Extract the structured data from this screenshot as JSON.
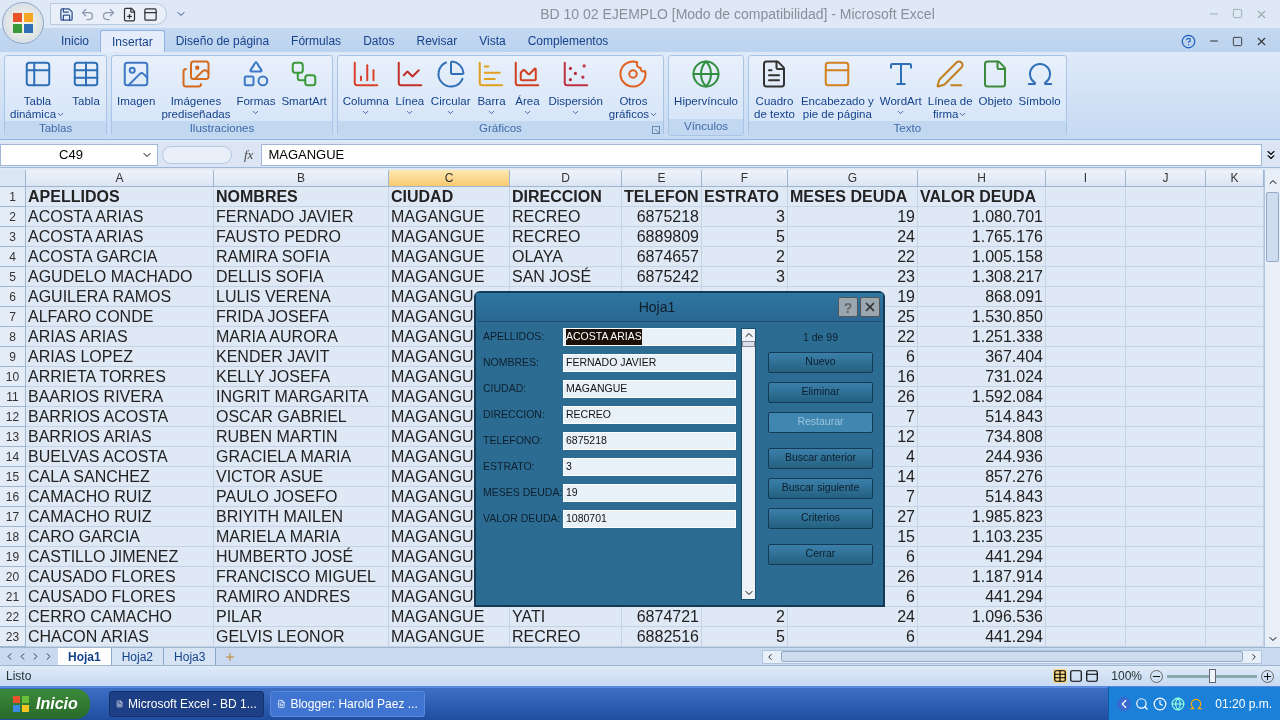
{
  "window": {
    "title": "BD 10 02 EJEMPLO  [Modo de compatibilidad] - Microsoft Excel"
  },
  "ribbon_tabs": [
    {
      "label": "Inicio",
      "selected": false
    },
    {
      "label": "Insertar",
      "selected": true
    },
    {
      "label": "Diseño de página",
      "selected": false
    },
    {
      "label": "Fórmulas",
      "selected": false
    },
    {
      "label": "Datos",
      "selected": false
    },
    {
      "label": "Revisar",
      "selected": false
    },
    {
      "label": "Vista",
      "selected": false
    },
    {
      "label": "Complementos",
      "selected": false
    }
  ],
  "ribbon_groups": [
    {
      "label": "Tablas",
      "launcher": false,
      "items": [
        {
          "lines": [
            "Tabla",
            "dinámica"
          ],
          "dropdown": true
        },
        {
          "lines": [
            "Tabla"
          ],
          "dropdown": false
        }
      ]
    },
    {
      "label": "Ilustraciones",
      "launcher": false,
      "items": [
        {
          "lines": [
            "Imagen"
          ],
          "dropdown": false
        },
        {
          "lines": [
            "Imágenes",
            "prediseñadas"
          ],
          "dropdown": false
        },
        {
          "lines": [
            "Formas"
          ],
          "dropdown": true
        },
        {
          "lines": [
            "SmartArt"
          ],
          "dropdown": false
        }
      ]
    },
    {
      "label": "Gráficos",
      "launcher": true,
      "items": [
        {
          "lines": [
            "Columna"
          ],
          "dropdown": true
        },
        {
          "lines": [
            "Línea"
          ],
          "dropdown": true
        },
        {
          "lines": [
            "Circular"
          ],
          "dropdown": true
        },
        {
          "lines": [
            "Barra"
          ],
          "dropdown": true
        },
        {
          "lines": [
            "Área"
          ],
          "dropdown": true
        },
        {
          "lines": [
            "Dispersión"
          ],
          "dropdown": true
        },
        {
          "lines": [
            "Otros",
            "gráficos"
          ],
          "dropdown": true
        }
      ]
    },
    {
      "label": "Vínculos",
      "launcher": false,
      "items": [
        {
          "lines": [
            "Hipervínculo"
          ],
          "dropdown": false
        }
      ]
    },
    {
      "label": "Texto",
      "launcher": false,
      "items": [
        {
          "lines": [
            "Cuadro",
            "de texto"
          ],
          "dropdown": false
        },
        {
          "lines": [
            "Encabezado y",
            "pie de página"
          ],
          "dropdown": false
        },
        {
          "lines": [
            "WordArt"
          ],
          "dropdown": true
        },
        {
          "lines": [
            "Línea de",
            "firma"
          ],
          "dropdown": true
        },
        {
          "lines": [
            "Objeto"
          ],
          "dropdown": false
        },
        {
          "lines": [
            "Símbolo"
          ],
          "dropdown": false
        }
      ]
    }
  ],
  "formula_bar": {
    "name_box": "C49",
    "fx": "fx",
    "formula": "MAGANGUE"
  },
  "columns": [
    {
      "label": "A",
      "selected": false
    },
    {
      "label": "B",
      "selected": false
    },
    {
      "label": "C",
      "selected": true
    },
    {
      "label": "D",
      "selected": false
    },
    {
      "label": "E",
      "selected": false
    },
    {
      "label": "F",
      "selected": false
    },
    {
      "label": "G",
      "selected": false
    },
    {
      "label": "H",
      "selected": false
    },
    {
      "label": "I",
      "selected": false
    },
    {
      "label": "J",
      "selected": false
    },
    {
      "label": "K",
      "selected": false
    }
  ],
  "header_row": {
    "n": "1",
    "A": "APELLIDOS",
    "B": "NOMBRES",
    "C": "CIUDAD",
    "D": "DIRECCION",
    "E": "TELEFON",
    "F": "ESTRATO",
    "G": "MESES DEUDA",
    "H": "VALOR DEUDA"
  },
  "rows": [
    {
      "n": "2",
      "A": "ACOSTA ARIAS",
      "B": "FERNADO JAVIER",
      "C": "MAGANGUE",
      "D": "RECREO",
      "E": "6875218",
      "F": "3",
      "G": "19",
      "H": "1.080.701"
    },
    {
      "n": "3",
      "A": "ACOSTA ARIAS",
      "B": "FAUSTO PEDRO",
      "C": "MAGANGUE",
      "D": "RECREO",
      "E": "6889809",
      "F": "5",
      "G": "24",
      "H": "1.765.176"
    },
    {
      "n": "4",
      "A": "ACOSTA GARCIA",
      "B": "RAMIRA SOFIA",
      "C": "MAGANGUE",
      "D": "OLAYA",
      "E": "6874657",
      "F": "2",
      "G": "22",
      "H": "1.005.158"
    },
    {
      "n": "5",
      "A": "AGUDELO MACHADO",
      "B": "DELLIS SOFIA",
      "C": "MAGANGUE",
      "D": "SAN JOSÉ",
      "E": "6875242",
      "F": "3",
      "G": "23",
      "H": "1.308.217"
    },
    {
      "n": "6",
      "A": "AGUILERA RAMOS",
      "B": "LULIS VERENA",
      "C": "MAGANGU",
      "G": "19",
      "H": "868.091"
    },
    {
      "n": "7",
      "A": "ALFARO CONDE",
      "B": "FRIDA JOSEFA",
      "C": "MAGANGU",
      "G": "25",
      "H": "1.530.850"
    },
    {
      "n": "8",
      "A": "ARIAS ARIAS",
      "B": "MARIA AURORA",
      "C": "MAGANGU",
      "G": "22",
      "H": "1.251.338"
    },
    {
      "n": "9",
      "A": "ARIAS LOPEZ",
      "B": "KENDER JAVIT",
      "C": "MAGANGU",
      "G": "6",
      "H": "367.404"
    },
    {
      "n": "10",
      "A": "ARRIETA TORRES",
      "B": "KELLY JOSEFA",
      "C": "MAGANGU",
      "G": "16",
      "H": "731.024"
    },
    {
      "n": "11",
      "A": "BAARIOS RIVERA",
      "B": "INGRIT MARGARITA",
      "C": "MAGANGU",
      "G": "26",
      "H": "1.592.084"
    },
    {
      "n": "12",
      "A": "BARRIOS ACOSTA",
      "B": "OSCAR GABRIEL",
      "C": "MAGANGU",
      "G": "7",
      "H": "514.843"
    },
    {
      "n": "13",
      "A": "BARRIOS ARIAS",
      "B": "RUBEN MARTIN",
      "C": "MAGANGU",
      "G": "12",
      "H": "734.808"
    },
    {
      "n": "14",
      "A": "BUELVAS ACOSTA",
      "B": "GRACIELA MARIA",
      "C": "MAGANGU",
      "G": "4",
      "H": "244.936"
    },
    {
      "n": "15",
      "A": "CALA SANCHEZ",
      "B": "VICTOR ASUE",
      "C": "MAGANGU",
      "G": "14",
      "H": "857.276"
    },
    {
      "n": "16",
      "A": "CAMACHO RUIZ",
      "B": "PAULO JOSEFO",
      "C": "MAGANGU",
      "G": "7",
      "H": "514.843"
    },
    {
      "n": "17",
      "A": "CAMACHO RUIZ",
      "B": "BRIYITH MAILEN",
      "C": "MAGANGU",
      "G": "27",
      "H": "1.985.823"
    },
    {
      "n": "18",
      "A": "CARO GARCIA",
      "B": "MARIELA MARIA",
      "C": "MAGANGU",
      "G": "15",
      "H": "1.103.235"
    },
    {
      "n": "19",
      "A": "CASTILLO JIMENEZ",
      "B": "HUMBERTO JOSÉ",
      "C": "MAGANGU",
      "G": "6",
      "H": "441.294"
    },
    {
      "n": "20",
      "A": "CAUSADO FLORES",
      "B": "FRANCISCO MIGUEL",
      "C": "MAGANGU",
      "G": "26",
      "H": "1.187.914"
    },
    {
      "n": "21",
      "A": "CAUSADO FLORES",
      "B": "RAMIRO ANDRES",
      "C": "MAGANGU",
      "G": "6",
      "H": "441.294"
    },
    {
      "n": "22",
      "A": "CERRO CAMACHO",
      "B": "PILAR",
      "C": "MAGANGUE",
      "D": "YATI",
      "E": "6874721",
      "F": "2",
      "G": "24",
      "H": "1.096.536"
    },
    {
      "n": "23",
      "A": "CHACON ARIAS",
      "B": "GELVIS LEONOR",
      "C": "MAGANGUE",
      "D": "RECREO",
      "E": "6882516",
      "F": "5",
      "G": "6",
      "H": "441.294"
    }
  ],
  "dialog": {
    "title": "Hoja1",
    "help": "?",
    "counter": "1 de 99",
    "fields": [
      {
        "label": "APELLIDOS:",
        "value": "ACOSTA ARIAS",
        "highlighted": true
      },
      {
        "label": "NOMBRES:",
        "value": "FERNADO JAVIER",
        "highlighted": false
      },
      {
        "label": "CIUDAD:",
        "value": "MAGANGUE",
        "highlighted": false
      },
      {
        "label": "DIRECCION:",
        "value": "RECREO",
        "highlighted": false
      },
      {
        "label": "TELEFONO:",
        "value": "6875218",
        "highlighted": false
      },
      {
        "label": "ESTRATO:",
        "value": "3",
        "highlighted": false
      },
      {
        "label": "MESES DEUDA:",
        "value": "19",
        "highlighted": false
      },
      {
        "label": "VALOR DEUDA:",
        "value": "1080701",
        "highlighted": false
      }
    ],
    "button_groups": [
      [
        {
          "label": "Nuevo",
          "disabled": false
        },
        {
          "label": "Eliminar",
          "disabled": false
        },
        {
          "label": "Restaurar",
          "disabled": true
        }
      ],
      [
        {
          "label": "Buscar anterior",
          "disabled": false
        },
        {
          "label": "Buscar siguiente",
          "disabled": false
        },
        {
          "label": "Criterios",
          "disabled": false
        }
      ],
      [
        {
          "label": "Cerrar",
          "disabled": false
        }
      ]
    ]
  },
  "sheet_tabs": [
    {
      "label": "Hoja1",
      "selected": true
    },
    {
      "label": "Hoja2",
      "selected": false
    },
    {
      "label": "Hoja3",
      "selected": false
    }
  ],
  "status_bar": {
    "text": "Listo",
    "zoom": "100%",
    "level": 0.5
  },
  "taskbar": {
    "start": "Inicio",
    "tasks": [
      {
        "label": "Microsoft Excel - BD 1...",
        "selected": true
      },
      {
        "label": "Blogger: Harold Paez ...",
        "selected": false
      }
    ],
    "clock": "01:20 p.m."
  }
}
